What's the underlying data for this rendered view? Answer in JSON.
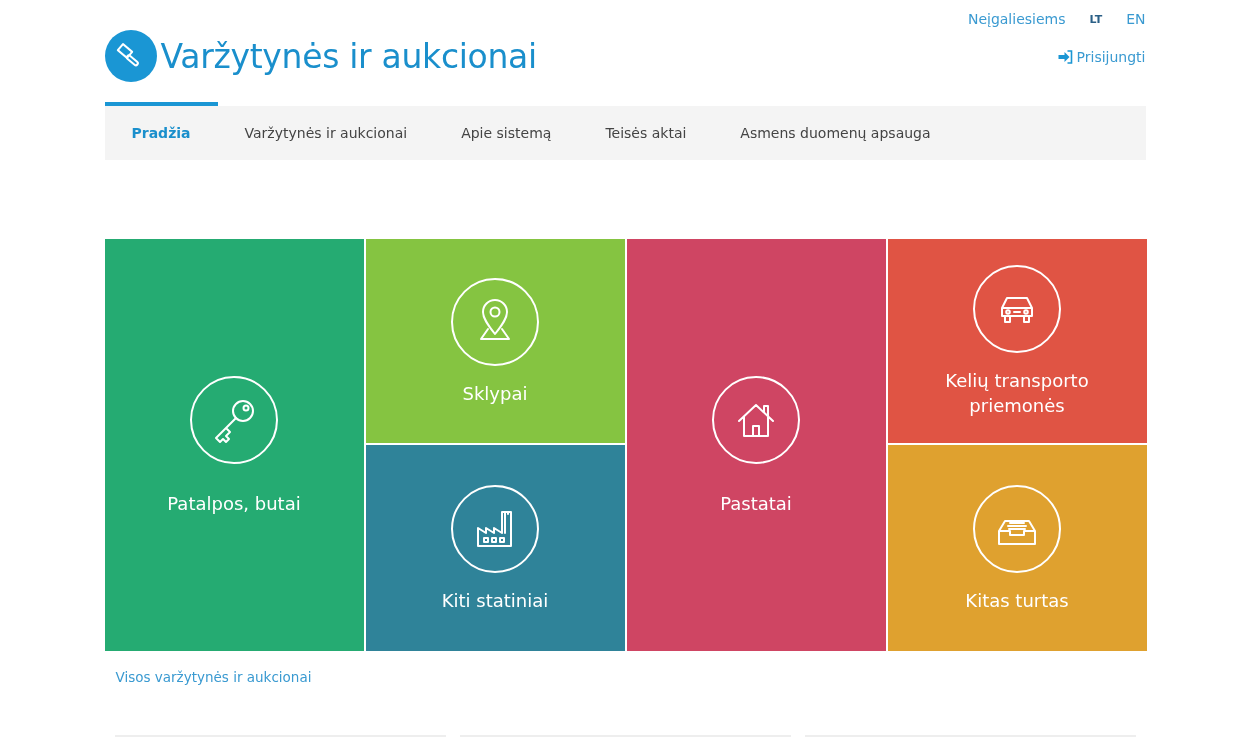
{
  "header": {
    "title": "Varžytynės ir aukcionai",
    "links": [
      "Neįgaliesiems"
    ],
    "languages": [
      {
        "label": "LT",
        "selected": true
      },
      {
        "label": "EN",
        "selected": false
      }
    ],
    "login": "Prisijungti"
  },
  "nav": [
    {
      "label": "Pradžia",
      "selected": true
    },
    {
      "label": "Varžytynės ir aukcionai",
      "selected": false
    },
    {
      "label": "Apie sistemą",
      "selected": false
    },
    {
      "label": "Teisės aktai",
      "selected": false
    },
    {
      "label": "Asmens duomenų apsauga",
      "selected": false
    }
  ],
  "tiles": [
    {
      "label": "Patalpos, butai",
      "kind": "tall",
      "color": "#25ab72"
    },
    {
      "label": "Sklypai",
      "kind": "short",
      "color": "#85c441"
    },
    {
      "label": "Kiti statiniai",
      "kind": "short",
      "color": "#2f8399"
    },
    {
      "label": "Pastatai",
      "kind": "tall",
      "color": "#cf4563"
    },
    {
      "label": "Kelių transporto priemonės",
      "kind": "short",
      "color": "#e05444"
    },
    {
      "label": "Kitas turtas",
      "kind": "short",
      "color": "#dfa12f"
    }
  ],
  "all_link": "Visos varžytynės ir aukcionai"
}
